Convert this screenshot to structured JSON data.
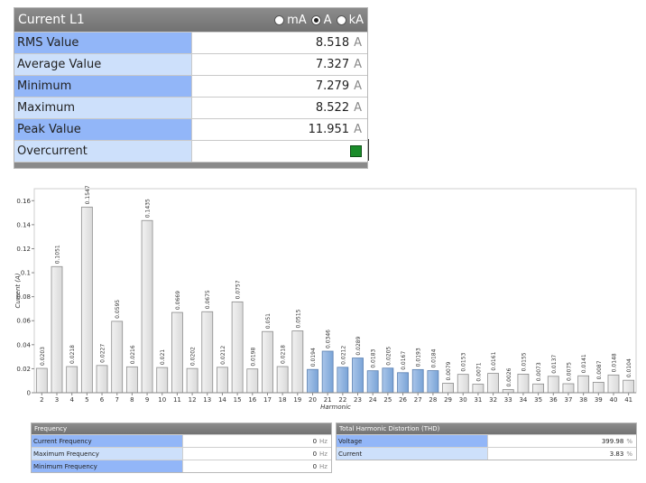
{
  "current_panel": {
    "title": "Current L1",
    "unit_options": [
      {
        "label": "mA",
        "selected": false
      },
      {
        "label": "A",
        "selected": true
      },
      {
        "label": "kA",
        "selected": false
      }
    ],
    "rows": [
      {
        "label": "RMS Value",
        "value": "8.518",
        "unit": "A"
      },
      {
        "label": "Average Value",
        "value": "7.327",
        "unit": "A"
      },
      {
        "label": "Minimum",
        "value": "7.279",
        "unit": "A"
      },
      {
        "label": "Maximum",
        "value": "8.522",
        "unit": "A"
      },
      {
        "label": "Peak Value",
        "value": "11.951",
        "unit": "A"
      }
    ],
    "overcurrent": {
      "label": "Overcurrent",
      "indicator_color": "#1a8c2a"
    }
  },
  "chart_data": {
    "type": "bar",
    "title": "",
    "xlabel": "Harmonic",
    "ylabel": "Current (A)",
    "ylim": [
      0,
      0.17
    ],
    "yticks": [
      "0",
      "0.02",
      "0.04",
      "0.06",
      "0.08",
      "0.1",
      "0.12",
      "0.14",
      "0.16"
    ],
    "grid": false,
    "categories": [
      "2",
      "3",
      "4",
      "5",
      "6",
      "7",
      "8",
      "9",
      "10",
      "11",
      "12",
      "13",
      "14",
      "15",
      "16",
      "17",
      "18",
      "19",
      "20",
      "21",
      "22",
      "23",
      "24",
      "25",
      "26",
      "27",
      "28",
      "29",
      "30",
      "31",
      "32",
      "33",
      "34",
      "35",
      "36",
      "37",
      "38",
      "39",
      "40",
      "41"
    ],
    "values": [
      0.0203,
      0.1051,
      0.0218,
      0.1547,
      0.0227,
      0.0595,
      0.0216,
      0.1435,
      0.021,
      0.0669,
      0.0202,
      0.0675,
      0.0212,
      0.0757,
      0.0198,
      0.051,
      0.0218,
      0.0515,
      0.0194,
      0.0346,
      0.0212,
      0.0289,
      0.0183,
      0.0205,
      0.0167,
      0.0193,
      0.0184,
      0.0079,
      0.0153,
      0.0071,
      0.0161,
      0.0026,
      0.0155,
      0.0073,
      0.0137,
      0.0075,
      0.0141,
      0.0087,
      0.0148,
      0.0104
    ],
    "labels": [
      "0.0203",
      "0.1051",
      "0.0218",
      "0.1547",
      "0.0227",
      "0.0595",
      "0.0216",
      "0.1435",
      "0.021",
      "0.0669",
      "0.0202",
      "0.0675",
      "0.0212",
      "0.0757",
      "0.0198",
      "0.051",
      "0.0218",
      "0.0515",
      "0.0194",
      "0.0346",
      "0.0212",
      "0.0289",
      "0.0183",
      "0.0205",
      "0.0167",
      "0.0193",
      "0.0184",
      "0.0079",
      "0.0153",
      "0.0071",
      "0.0161",
      "0.0026",
      "0.0155",
      "0.0073",
      "0.0137",
      "0.0075",
      "0.0141",
      "0.0087",
      "0.0148",
      "0.0104"
    ],
    "highlighted_categories": [
      "20",
      "21",
      "22",
      "23",
      "24",
      "25",
      "26",
      "27",
      "28"
    ],
    "colors": {
      "bar": "#d9d9d9",
      "bar_stroke": "#8c8c8c",
      "highlight": "#7aa3d6",
      "highlight_stroke": "#5a7fb0"
    }
  },
  "frequency_panel": {
    "title": "Frequency",
    "rows": [
      {
        "label": "Current Frequency",
        "value": "0",
        "unit": "Hz"
      },
      {
        "label": "Maximum Frequency",
        "value": "0",
        "unit": "Hz"
      },
      {
        "label": "Minimum Frequency",
        "value": "0",
        "unit": "Hz"
      }
    ]
  },
  "thd_panel": {
    "title": "Total Harmonic Distortion (THD)",
    "rows": [
      {
        "label": "Voltage",
        "value": "399.98",
        "unit": "%"
      },
      {
        "label": "Current",
        "value": "3.83",
        "unit": "%"
      }
    ]
  }
}
